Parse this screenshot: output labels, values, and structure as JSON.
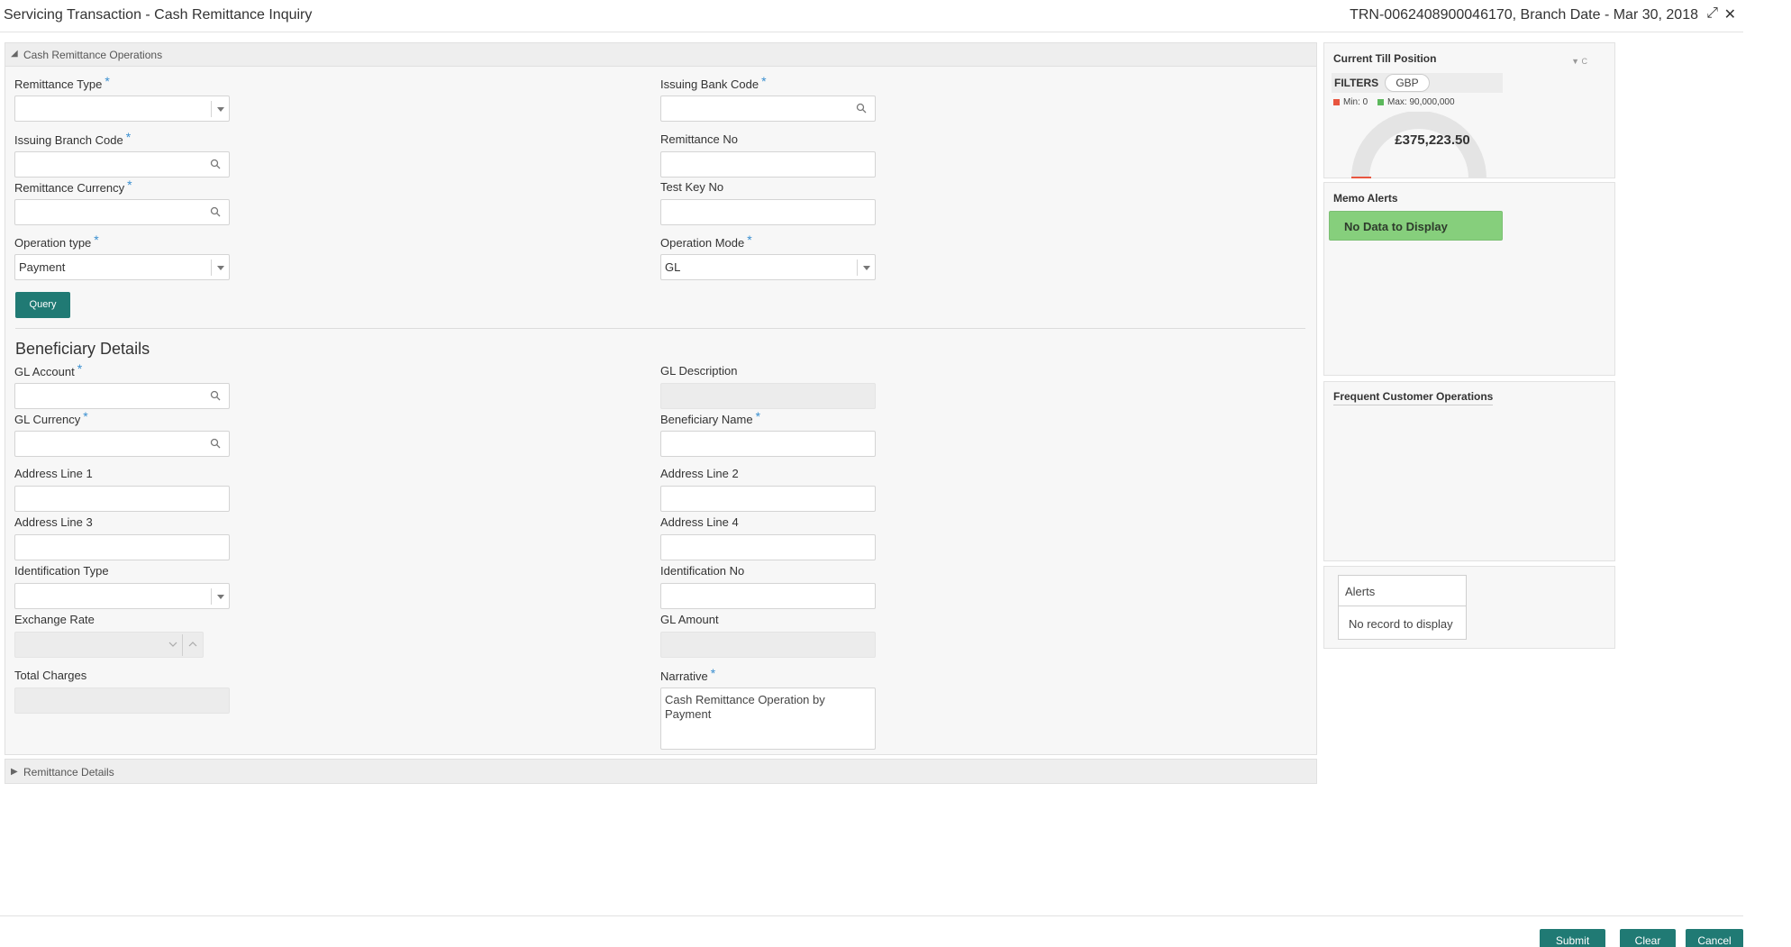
{
  "header": {
    "title": "Servicing Transaction - Cash Remittance Inquiry",
    "reference": "TRN-0062408900046170, Branch Date - Mar 30, 2018",
    "expand_glyph": "⤢",
    "close_glyph": "✕"
  },
  "section": {
    "title": "Cash Remittance Operations",
    "toggle_glyph": "◢"
  },
  "fields": {
    "remittance_type": {
      "label": "Remittance Type",
      "value": ""
    },
    "issuing_bank_code": {
      "label": "Issuing Bank Code",
      "value": ""
    },
    "issuing_branch_code": {
      "label": "Issuing Branch Code",
      "value": ""
    },
    "remittance_no": {
      "label": "Remittance No",
      "value": ""
    },
    "remittance_currency": {
      "label": "Remittance Currency",
      "value": ""
    },
    "test_key_no": {
      "label": "Test Key No",
      "value": ""
    },
    "operation_type": {
      "label": "Operation type",
      "value": "Payment"
    },
    "operation_mode": {
      "label": "Operation Mode",
      "value": "GL"
    }
  },
  "query_label": "Query",
  "beneficiary": {
    "title": "Beneficiary Details",
    "gl_account": {
      "label": "GL Account",
      "value": ""
    },
    "gl_description": {
      "label": "GL Description",
      "value": ""
    },
    "gl_currency": {
      "label": "GL Currency",
      "value": ""
    },
    "beneficiary_name": {
      "label": "Beneficiary Name",
      "value": ""
    },
    "address_line_1": {
      "label": "Address Line 1",
      "value": ""
    },
    "address_line_2": {
      "label": "Address Line 2",
      "value": ""
    },
    "address_line_3": {
      "label": "Address Line 3",
      "value": ""
    },
    "address_line_4": {
      "label": "Address Line 4",
      "value": ""
    },
    "identification_type": {
      "label": "Identification Type",
      "value": ""
    },
    "identification_no": {
      "label": "Identification No",
      "value": ""
    },
    "exchange_rate": {
      "label": "Exchange Rate",
      "value": ""
    },
    "gl_amount": {
      "label": "GL Amount",
      "value": ""
    },
    "total_charges": {
      "label": "Total Charges",
      "value": ""
    },
    "narrative": {
      "label": "Narrative",
      "value": "Cash Remittance Operation by Payment"
    }
  },
  "remittance_details": {
    "title": "Remittance Details",
    "toggle_glyph": "▶"
  },
  "till": {
    "title": "Current Till Position",
    "filters_label": "FILTERS",
    "currency_chip": "GBP",
    "min_label": "Min: 0",
    "max_label": "Max: 90,000,000",
    "amount": "£375,223.50",
    "min_color": "#e8553f",
    "max_color": "#5cb85c"
  },
  "memo": {
    "title": "Memo Alerts",
    "message": "No Data to Display"
  },
  "frequent": {
    "title": "Frequent Customer Operations"
  },
  "alerts": {
    "title": "Alerts",
    "message": "No record to display"
  },
  "footer": {
    "submit": "Submit",
    "clear": "Clear",
    "cancel": "Cancel"
  },
  "colors": {
    "accent": "#207a74",
    "required": "#3a8fd0",
    "memo_green": "#86cf7c"
  }
}
